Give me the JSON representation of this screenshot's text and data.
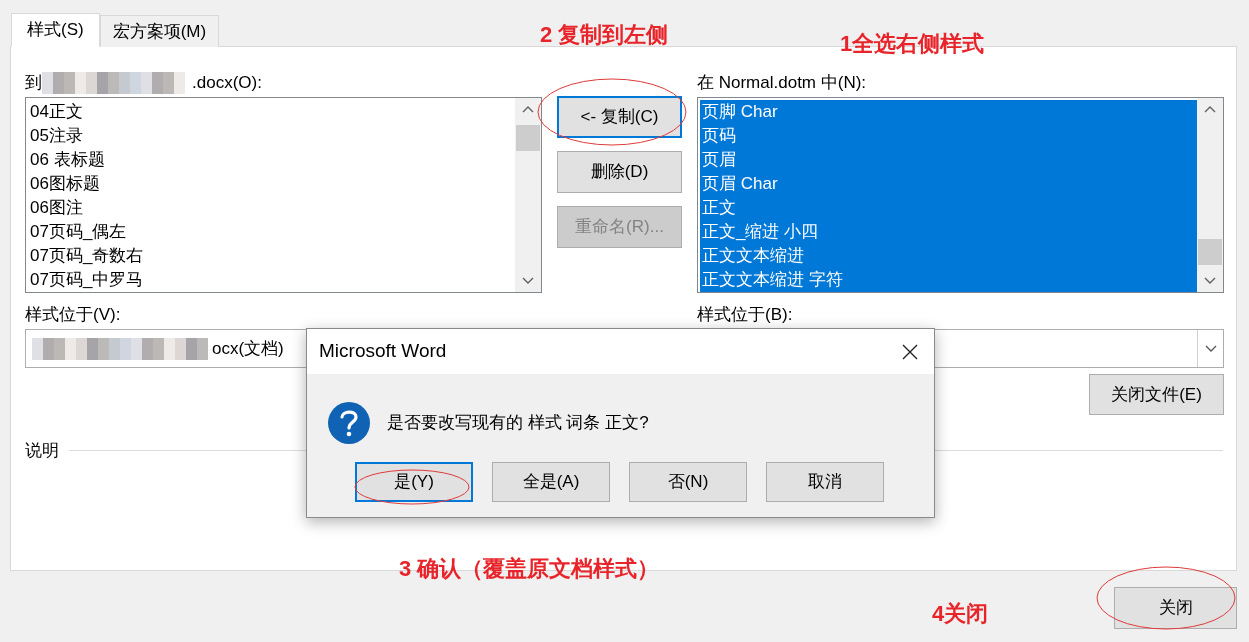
{
  "tabs": [
    {
      "label": "样式(S)",
      "selected": true
    },
    {
      "label": "宏方案项(M)",
      "selected": false
    }
  ],
  "left_pane": {
    "label_start": "到",
    "label_end": ".docx(O):",
    "items": [
      {
        "label": "04正文",
        "selected": false
      },
      {
        "label": "05注录",
        "selected": false
      },
      {
        "label": "06 表标题",
        "selected": false
      },
      {
        "label": "06图标题",
        "selected": false
      },
      {
        "label": "06图注",
        "selected": false
      },
      {
        "label": "07页码_偶左",
        "selected": false
      },
      {
        "label": "07页码_奇数右",
        "selected": false
      },
      {
        "label": "07页码_中罗马",
        "selected": false
      }
    ],
    "location_label": "样式位于(V):",
    "location_value_end": "ocx(文档)"
  },
  "middle_buttons": [
    {
      "label": "<- 复制(C)",
      "focused": true,
      "disabled": false
    },
    {
      "label": "删除(D)",
      "focused": false,
      "disabled": false
    },
    {
      "label": "重命名(R)...",
      "focused": false,
      "disabled": true
    }
  ],
  "right_pane": {
    "label": "在 Normal.dotm 中(N):",
    "items": [
      {
        "label": "页脚 Char",
        "selected": true
      },
      {
        "label": "页码",
        "selected": true
      },
      {
        "label": "页眉",
        "selected": true
      },
      {
        "label": "页眉 Char",
        "selected": true
      },
      {
        "label": "正文",
        "selected": true
      },
      {
        "label": "正文_缩进 小四",
        "selected": true
      },
      {
        "label": "正文文本缩进",
        "selected": true
      },
      {
        "label": "正文文本缩进 字符",
        "selected": true
      }
    ],
    "location_label": "样式位于(B):",
    "close_file_button": "关闭文件(E)"
  },
  "description_label": "说明",
  "close_button": "关闭",
  "message_box": {
    "title": "Microsoft Word",
    "message": "是否要改写现有的 样式 词条 正文?",
    "buttons": [
      {
        "label": "是(Y)",
        "focused": true
      },
      {
        "label": "全是(A)",
        "focused": false
      },
      {
        "label": "否(N)",
        "focused": false
      },
      {
        "label": "取消",
        "focused": false
      }
    ]
  },
  "annotations": [
    {
      "text": "2 复制到左侧"
    },
    {
      "text": "1全选右侧样式"
    },
    {
      "text": "3 确认（覆盖原文档样式）"
    },
    {
      "text": "4关闭"
    }
  ]
}
